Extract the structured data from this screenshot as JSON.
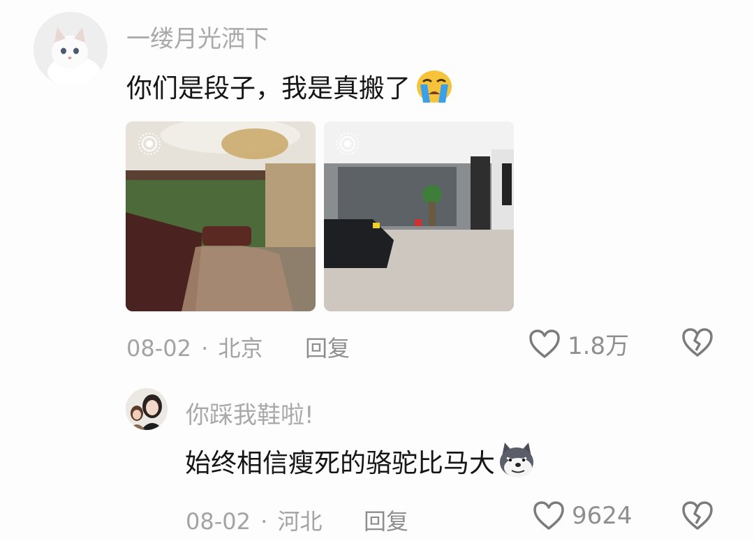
{
  "comments": [
    {
      "username": "一缕月光洒下",
      "text": "你们是段子，我是真搬了",
      "emoji": "crying-face-icon",
      "photos": [
        "living-room-photo-1",
        "living-room-photo-2"
      ],
      "date": "08-02",
      "location": "北京",
      "reply_label": "回复",
      "like_count": "1.8万"
    },
    {
      "username": "你踩我鞋啦!",
      "text": "始终相信瘦死的骆驼比马大",
      "emoji": "husky-dog-icon",
      "date": "08-02",
      "location": "河北",
      "reply_label": "回复",
      "like_count": "9624"
    }
  ],
  "separator": "·",
  "colors": {
    "background": "#fdfdfd",
    "username": "#a9a9a9",
    "text": "#151515",
    "meta": "#a3a3a3"
  }
}
